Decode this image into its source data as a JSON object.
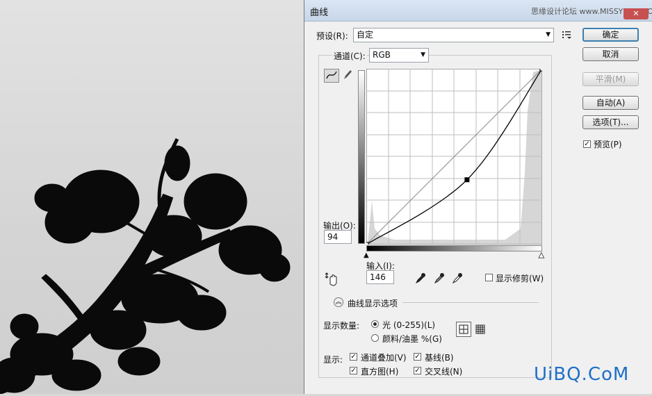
{
  "dialog": {
    "title": "曲线",
    "watermark_top": "思缘设计论坛 www.MISSYUAN.COM",
    "close_glyph": "✕"
  },
  "preset": {
    "label": "预设(R):",
    "value": "自定",
    "menu_icon": "preset-options-icon"
  },
  "channel": {
    "label": "通道(C):",
    "value": "RGB"
  },
  "buttons": {
    "ok": "确定",
    "cancel": "取消",
    "smooth": "平滑(M)",
    "auto": "自动(A)",
    "options": "选项(T)..."
  },
  "preview": {
    "label": "预览(P)",
    "checked": true
  },
  "output": {
    "label": "输出(O):",
    "value": "94"
  },
  "input": {
    "label": "输入(I):",
    "value": "146"
  },
  "show_clipping": {
    "label": "显示修剪(W)",
    "checked": false
  },
  "display_options": {
    "title": "曲线显示选项"
  },
  "show_amount": {
    "label": "显示数量:",
    "light": "光 (0-255)(L)",
    "pigment": "颜料/油墨 %(G)",
    "selected": "light"
  },
  "show": {
    "label": "显示:",
    "channel_overlays": "通道叠加(V)",
    "baseline": "基线(B)",
    "histogram": "直方图(H)",
    "intersection": "交叉线(N)"
  },
  "curve": {
    "range": [
      0,
      255
    ],
    "points": [
      [
        0,
        0
      ],
      [
        146,
        94
      ],
      [
        255,
        255
      ]
    ]
  },
  "bottom_watermark": "UiBQ.CoM",
  "colors": {
    "accent": "#3c7fb1",
    "title_bg": "#c7d6e9",
    "watermark": "#1e6fc8"
  }
}
